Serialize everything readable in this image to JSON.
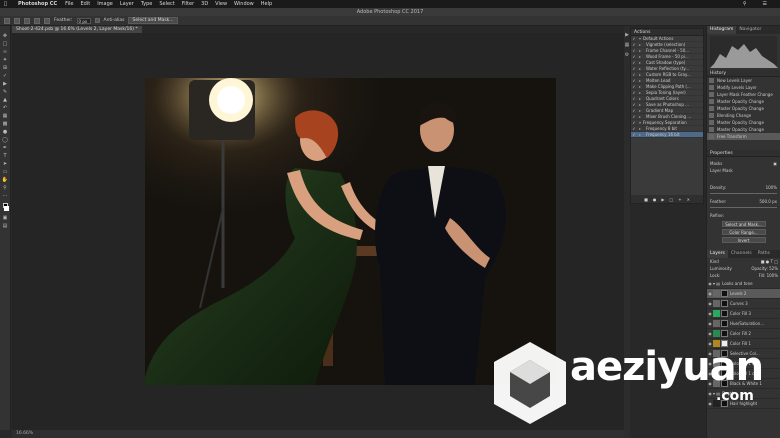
{
  "menubar": {
    "app_name": "Photoshop CC",
    "items": [
      "File",
      "Edit",
      "Image",
      "Layer",
      "Type",
      "Select",
      "Filter",
      "3D",
      "View",
      "Window",
      "Help"
    ]
  },
  "window": {
    "title": "Adobe Photoshop CC 2017"
  },
  "options": {
    "feather_label": "Feather:",
    "feather_value": "0 px",
    "antialias_label": "Anti-alias",
    "select_mask_label": "Select and Mask..."
  },
  "document_tab": {
    "label": "Shoot-2-424.psb @ 16.6% (Levels 2, Layer Mask/16) *"
  },
  "status": {
    "text": "16.66%"
  },
  "actions": {
    "title": "Actions",
    "items": [
      {
        "label": "Default Actions",
        "level": 0
      },
      {
        "label": "Vignette (selection)",
        "level": 1
      },
      {
        "label": "Frame Channel - 50...",
        "level": 1
      },
      {
        "label": "Wood Frame - 50 pi...",
        "level": 1
      },
      {
        "label": "Cast Shadow (type)",
        "level": 1
      },
      {
        "label": "Water Reflection (ty...",
        "level": 1
      },
      {
        "label": "Custom RGB to Gray...",
        "level": 1
      },
      {
        "label": "Molten Lead",
        "level": 1
      },
      {
        "label": "Make Clipping Path (...",
        "level": 1
      },
      {
        "label": "Sepia Toning (layer)",
        "level": 1
      },
      {
        "label": "Quadrant Colors",
        "level": 1
      },
      {
        "label": "Save as Photoshop ...",
        "level": 1
      },
      {
        "label": "Gradient Map",
        "level": 1
      },
      {
        "label": "Mixer Brush Cloning ...",
        "level": 1
      },
      {
        "label": "Frequency Separation",
        "level": 0
      },
      {
        "label": "Frequency 8 bit",
        "level": 1
      },
      {
        "label": "Frequency 16 bit",
        "level": 1
      }
    ]
  },
  "history": {
    "tabs": [
      "Histogram",
      "Navigator"
    ],
    "title": "History",
    "items": [
      "New Levels Layer",
      "Modify Levels Layer",
      "Layer Mask Feather Change",
      "Master Opacity Change",
      "Master Opacity Change",
      "Blending Change",
      "Master Opacity Change",
      "Master Opacity Change",
      "Free Transform"
    ]
  },
  "properties": {
    "title": "Properties",
    "masks_label": "Masks",
    "layer_mask_label": "Layer Mask",
    "density_label": "Density:",
    "density_value": "100%",
    "feather_label": "Feather:",
    "feather_value": "500.0 px",
    "refine_label": "Refine:",
    "select_mask_btn": "Select and Mask...",
    "color_range_btn": "Color Range...",
    "invert_btn": "Invert"
  },
  "layers": {
    "tabs": [
      "Layers",
      "Channels",
      "Paths"
    ],
    "kind_label": "Kind",
    "blend_mode": "Luminosity",
    "opacity_label": "Opacity:",
    "opacity_value": "52%",
    "lock_label": "Lock:",
    "fill_label": "Fill:",
    "fill_value": "100%",
    "items": [
      {
        "name": "Looks and tone",
        "thumb": "#555",
        "mask": "",
        "group": true
      },
      {
        "name": "Levels 2",
        "thumb": "#666",
        "mask": "#111",
        "selected": true
      },
      {
        "name": "Curves 3",
        "thumb": "#666",
        "mask": "#111"
      },
      {
        "name": "Color Fill 3",
        "thumb": "#2aa860",
        "mask": "#111"
      },
      {
        "name": "Hue/Saturation...",
        "thumb": "#666",
        "mask": "#111"
      },
      {
        "name": "Color Fill 2",
        "thumb": "#2a8a50",
        "mask": "#111"
      },
      {
        "name": "Color Fill 1",
        "thumb": "#b0861e",
        "mask": "#eee"
      },
      {
        "name": "Selective Col...",
        "thumb": "#666",
        "mask": "#111"
      },
      {
        "name": "Color Fill 1 c...",
        "thumb": "#777",
        "mask": "#111"
      },
      {
        "name": "Color Fill 1 c...",
        "thumb": "#777",
        "mask": "#111"
      },
      {
        "name": "Black & White 1",
        "thumb": "#666",
        "mask": "#111"
      },
      {
        "name": "Depth",
        "thumb": "#444",
        "mask": "",
        "group": true
      },
      {
        "name": "Hair highlight",
        "thumb": "#222",
        "mask": "#111"
      }
    ]
  },
  "watermark": {
    "text": "aeziyuan",
    "suffix": ".com"
  }
}
